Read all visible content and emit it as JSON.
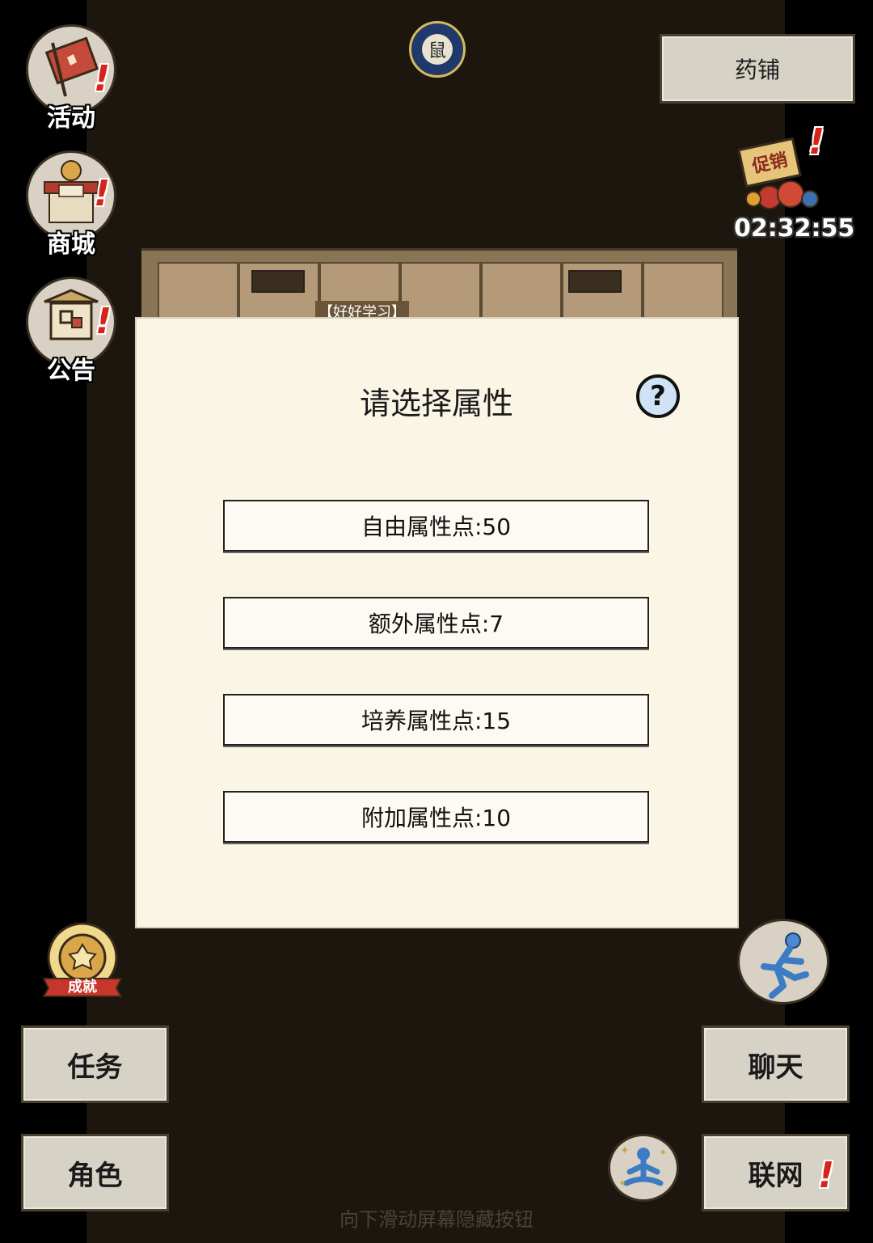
{
  "top_left_menu": {
    "activity_label": "活动",
    "shop_label": "商城",
    "notice_label": "公告"
  },
  "top_right": {
    "pharmacy_label": "药铺",
    "promo_sign": "促销",
    "promo_timer": "02:32:55"
  },
  "moon_icon_glyph": "鼠",
  "building_sign": "【好好学习】",
  "dialog": {
    "title": "请选择属性",
    "help_glyph": "?",
    "options": [
      "自由属性点:50",
      "额外属性点:7",
      "培养属性点:15",
      "附加属性点:10"
    ]
  },
  "bottom_left": {
    "achievement_label": "成就",
    "task_label": "任务",
    "character_label": "角色"
  },
  "bottom_right": {
    "chat_label": "聊天",
    "network_label": "联网"
  },
  "hint_text": "向下滑动屏幕隐藏按钮",
  "alert_glyph": "!",
  "colors": {
    "background": "#1c160e",
    "dialog_bg": "#fbf5e6",
    "alert_red": "#d8231b",
    "button_bg": "#d7d2c6"
  }
}
